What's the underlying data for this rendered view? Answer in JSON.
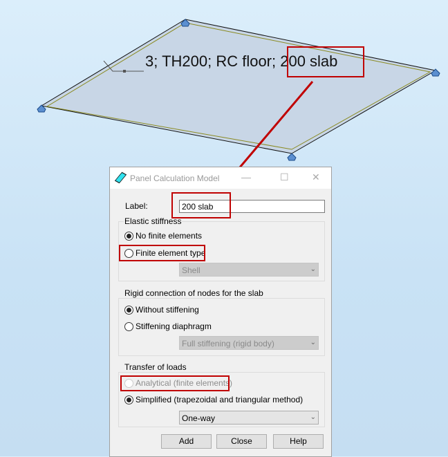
{
  "viewport": {
    "slab_annotation": "3; TH200; RC floor; 200 slab"
  },
  "dialog": {
    "title": "Panel Calculation Model",
    "label_caption": "Label:",
    "label_value": "200 slab",
    "elastic": {
      "title": "Elastic stiffness",
      "opt1": "No finite elements",
      "opt2": "Finite element type",
      "combo": "Shell",
      "selected": "No finite elements"
    },
    "rigid": {
      "title": "Rigid connection of nodes for the slab",
      "opt1": "Without stiffening",
      "opt2": "Stiffening diaphragm",
      "combo": "Full stiffening (rigid body)",
      "selected": "Without stiffening"
    },
    "loads": {
      "title": "Transfer of loads",
      "opt1": "Analytical (finite elements)",
      "opt2": "Simplified (trapezoidal and triangular method)",
      "combo": "One-way",
      "selected": "Simplified (trapezoidal and triangular method)"
    },
    "buttons": {
      "add": "Add",
      "close": "Close",
      "help": "Help"
    }
  },
  "colors": {
    "highlight": "#c00000",
    "slab_fill": "#c8d8e8"
  }
}
